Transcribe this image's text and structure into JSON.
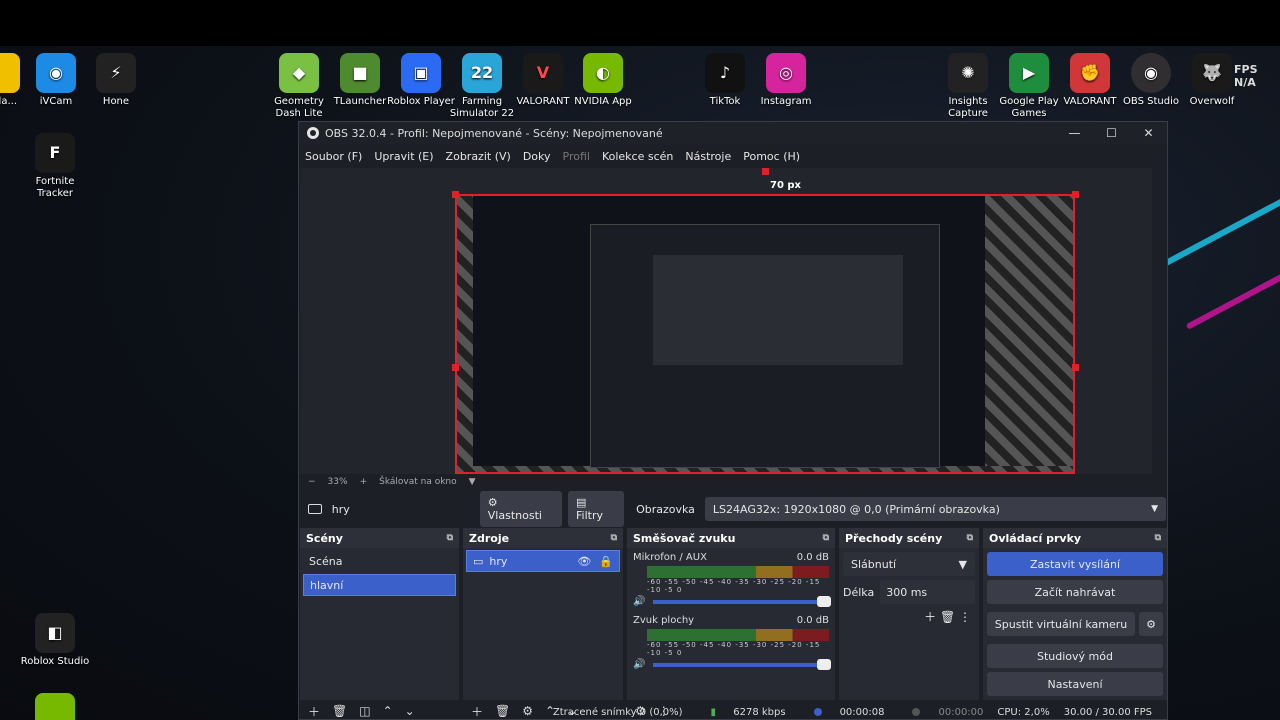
{
  "desktop": {
    "fps_label": "FPS N/A",
    "icons": [
      {
        "label": "...Pla...",
        "icon": "app-icon",
        "color": "#f0c000"
      },
      {
        "label": "iVCam",
        "icon": "camera-icon",
        "color": "#1d8ae5"
      },
      {
        "label": "Hone",
        "icon": "hone-icon",
        "color": "#222222"
      },
      {
        "label": "Geometry Dash Lite",
        "icon": "geometry-dash-icon",
        "color": "#7ac143"
      },
      {
        "label": "TLauncher",
        "icon": "minecraft-icon",
        "color": "#4e8a2e"
      },
      {
        "label": "Roblox Player",
        "icon": "roblox-icon",
        "color": "#2b6bf3"
      },
      {
        "label": "Farming Simulator 22",
        "icon": "farming-simulator-icon",
        "color": "#2aa5d8"
      },
      {
        "label": "VALORANT",
        "icon": "valorant-icon",
        "color": "#1a1a1a"
      },
      {
        "label": "NVIDIA App",
        "icon": "nvidia-icon",
        "color": "#76b900"
      },
      {
        "label": "TikTok",
        "icon": "tiktok-icon",
        "color": "#111111"
      },
      {
        "label": "Instagram",
        "icon": "instagram-icon",
        "color": "#d6249f"
      },
      {
        "label": "Insights Capture",
        "icon": "insights-capture-icon",
        "color": "#222222"
      },
      {
        "label": "Google Play Games",
        "icon": "google-play-games-icon",
        "color": "#1e8e3e"
      },
      {
        "label": "VALORANT",
        "icon": "valorant-riot-icon",
        "color": "#d13639"
      },
      {
        "label": "OBS Studio",
        "icon": "obs-icon",
        "color": "#302e31"
      },
      {
        "label": "Overwolf",
        "icon": "overwolf-icon",
        "color": "#1a1a1a"
      },
      {
        "label": "Fortnite Tracker",
        "icon": "fortnite-tracker-icon",
        "color": "#1a1a1a"
      },
      {
        "label": "Roblox Studio",
        "icon": "roblox-studio-icon",
        "color": "#222222"
      }
    ]
  },
  "obs": {
    "title": "OBS 32.0.4 - Profil: Nepojmenované - Scény: Nepojmenované",
    "menu": [
      "Soubor (F)",
      "Upravit (E)",
      "Zobrazit (V)",
      "Doky",
      "Profil",
      "Kolekce scén",
      "Nástroje",
      "Pomoc (H)"
    ],
    "preview": {
      "px_label": "70 px"
    },
    "zoom": {
      "minus": "−",
      "value": "33%",
      "plus": "+",
      "scale_label": "Škálovat na okno"
    },
    "source_bar": {
      "source_name": "hry",
      "properties": "Vlastnosti",
      "filters": "Filtry",
      "display_label": "Obrazovka",
      "display_value": "LS24AG32x: 1920x1080 @ 0,0 (Primární obrazovka)"
    },
    "scenes": {
      "title": "Scény",
      "items": [
        "Scéna",
        "hlavní"
      ]
    },
    "sources": {
      "title": "Zdroje",
      "items": [
        "hry"
      ]
    },
    "mixer": {
      "title": "Směšovač zvuku",
      "channels": [
        {
          "name": "Mikrofon / AUX",
          "db": "0.0 dB"
        },
        {
          "name": "Zvuk plochy",
          "db": "0.0 dB"
        }
      ],
      "ticks": "-60 -55 -50 -45 -40 -35 -30 -25 -20 -15 -10 -5 0"
    },
    "transitions": {
      "title": "Přechody scény",
      "type": "Slábnutí",
      "duration_label": "Délka",
      "duration": "300 ms"
    },
    "controls": {
      "title": "Ovládací prvky",
      "stop_stream": "Zastavit vysílání",
      "start_record": "Začít nahrávat",
      "virtual_cam": "Spustit virtuální kameru",
      "studio_mode": "Studiový mód",
      "settings": "Nastavení"
    },
    "status": {
      "dropped": "Ztracené snímky 0 (0,0%)",
      "bitrate": "6278 kbps",
      "stream_time": "00:00:08",
      "rec_time": "00:00:00",
      "cpu": "CPU: 2,0%",
      "fps": "30.00 / 30.00 FPS"
    }
  }
}
